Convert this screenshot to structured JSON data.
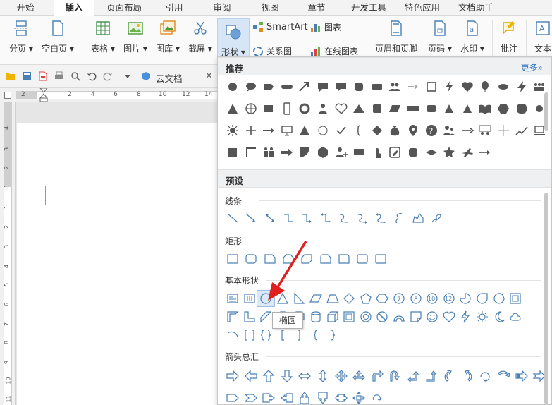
{
  "tabs": [
    {
      "label": "开始",
      "x": 28
    },
    {
      "label": "插入",
      "active": true
    },
    {
      "label": "页面布局"
    },
    {
      "label": "引用"
    },
    {
      "label": "审阅"
    },
    {
      "label": "视图"
    },
    {
      "label": "章节"
    },
    {
      "label": "开发工具"
    },
    {
      "label": "特色应用"
    },
    {
      "label": "文档助手"
    }
  ],
  "ribbon": {
    "page_break": "分页",
    "blank_page": "空白页",
    "table": "表格",
    "picture": "图片",
    "gallery": "图库",
    "screenshot": "截屏",
    "shapes": "形状",
    "smartart": "SmartArt",
    "chart": "图表",
    "relation": "关系图",
    "online_chart": "在线图表",
    "header_footer": "页眉和页脚",
    "page_number": "页码",
    "watermark": "水印",
    "comment": "批注",
    "textbox": "文本"
  },
  "qab": {
    "cloud_doc": "云文档"
  },
  "ruler": {
    "h_ticks": [
      "2",
      "2",
      "4",
      "6",
      "8",
      "10",
      "12",
      "14"
    ],
    "v_ticks": [
      "4",
      "3",
      "2",
      "1",
      "1",
      "2",
      "3",
      "4",
      "5",
      "6",
      "7",
      "8",
      "9",
      "10",
      "11"
    ]
  },
  "panel": {
    "recommended_title": "推荐",
    "more_label": "更多»",
    "presets_title": "预设",
    "categories": {
      "lines": "线条",
      "rectangles": "矩形",
      "basic": "基本形状",
      "arrows": "箭头总汇"
    },
    "tooltip": "椭圆"
  },
  "colors": {
    "accent_blue": "#2b73c8",
    "icon_gray": "#555555",
    "shape_stroke": "#4a7fb5",
    "arrow_red": "#e02020"
  }
}
